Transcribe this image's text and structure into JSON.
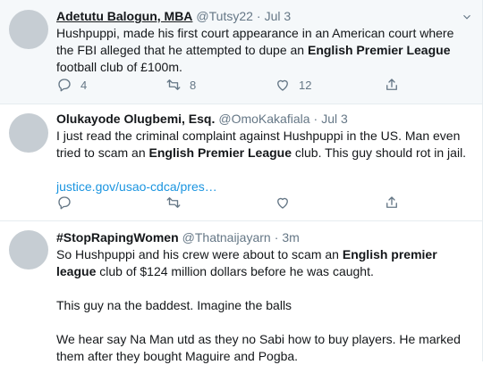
{
  "tweets": [
    {
      "name": "Adetutu Balogun, MBA",
      "handle": "@Tutsy22",
      "sep": "·",
      "time": "Jul 3",
      "text_parts": [
        "Hushpuppi, made his first court appearance in an American court where the FBI alleged that he attempted to dupe an ",
        "English Premier League",
        " football club of £100m."
      ],
      "replies": "4",
      "retweets": "8",
      "likes": "12"
    },
    {
      "name": "Olukayode Olugbemi, Esq.",
      "handle": "@OmoKakafiala",
      "sep": "·",
      "time": "Jul 3",
      "text_parts": [
        "I just read the criminal complaint against Hushpuppi in the US. Man even tried to scam an ",
        "English Premier League",
        " club. This guy should rot in jail."
      ],
      "link": "justice.gov/usao-cdca/pres…",
      "replies": "",
      "retweets": "",
      "likes": ""
    },
    {
      "name": "#StopRapingWomen",
      "handle": "@Thatnaijayarn",
      "sep": "·",
      "time": "3m",
      "text_parts": [
        "So Hushpuppi and his crew were about to scam an ",
        "English premier league",
        " club of $124 million dollars before he was caught."
      ],
      "para2": "This guy na the baddest. Imagine the balls",
      "para3": "We hear say Na Man utd as they no Sabi how to buy players. He marked them after they bought Maguire and Pogba."
    }
  ],
  "icons": [
    "chevron-down-icon",
    "reply-icon",
    "retweet-icon",
    "like-icon",
    "share-icon"
  ],
  "colors": {
    "name": "#14171a",
    "meta": "#657786",
    "link": "#1b95e0",
    "highlight_bg": "#f5f8fa",
    "divider": "#e6ecf0"
  }
}
